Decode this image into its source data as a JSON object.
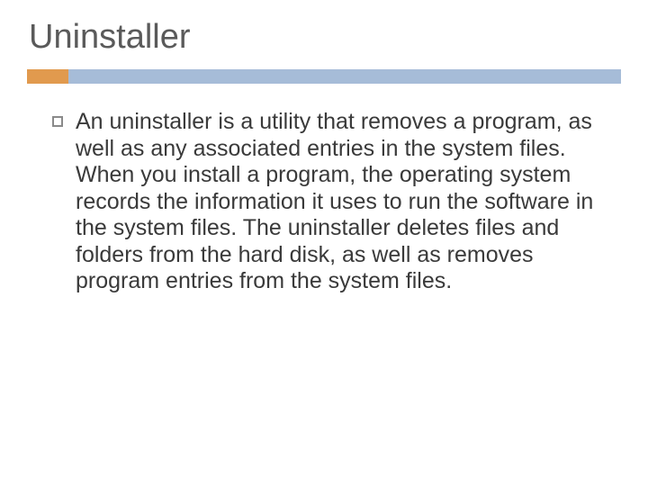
{
  "title": "Uninstaller",
  "body": "An uninstaller is a utility that removes a program, as well as any associated entries in the system files. When you install a program, the operating system records the information it uses to run the software in the system files. The uninstaller deletes files and folders from the hard disk, as well as removes program entries from the system files.",
  "colors": {
    "accent_orange": "#e19a4e",
    "accent_blue": "#a6bcd8"
  }
}
